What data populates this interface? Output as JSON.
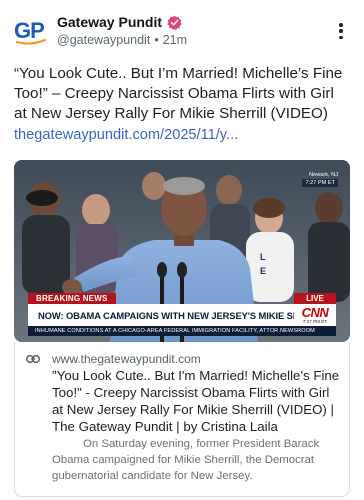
{
  "account": {
    "avatar_text": "GP",
    "display_name": "Gateway Pundit",
    "handle": "@gatewaypundit",
    "separator": "•",
    "time": "21m",
    "verified": true
  },
  "post": {
    "text": "“You Look Cute.. But I’m Married! Michelle’s Fine Too!” – Creepy Narcissist Obama Flirts with Girl at New Jersey Rally For Mikie Sherrill (VIDEO)",
    "link_text": "thegatewaypundit.com/2025/11/y..."
  },
  "media": {
    "location": "Newark, NJ",
    "corner_time": "7:27 PM ET",
    "breaking_label": "BREAKING NEWS",
    "live_label": "LIVE",
    "headline": "NOW: OBAMA CAMPAIGNS WITH NEW JERSEY'S MIKIE SHERRILL",
    "network": "CNN",
    "network_time": "7:27 PM ET",
    "ticker": "INHUMANE CONDITIONS AT A CHICAGO-AREA FEDERAL IMMIGRATION FACILITY, ATTOR NEWSROOM"
  },
  "link_card": {
    "domain": "www.thegatewaypundit.com",
    "title": "\"You Look Cute.. But I'm Married! Michelle's Fine Too!\" - Creepy Narcissist Obama Flirts with Girl at New Jersey Rally For Mikie Sherrill (VIDEO) | The Gateway Pundit | by Cristina Laila",
    "description": "On Saturday evening, former President Barack Obama campaigned for Mikie Sherrill, the Democrat gubernatorial candidate for New Jersey."
  },
  "colors": {
    "brand_blue": "#1f5bb5",
    "brand_orange": "#f59b1c",
    "badge": "#e0457b",
    "link": "#3a63c8",
    "breaking_red": "#b4141a"
  },
  "icons": {
    "verified": "verified-badge-icon",
    "more": "more-vertical-icon",
    "link": "link-icon"
  }
}
